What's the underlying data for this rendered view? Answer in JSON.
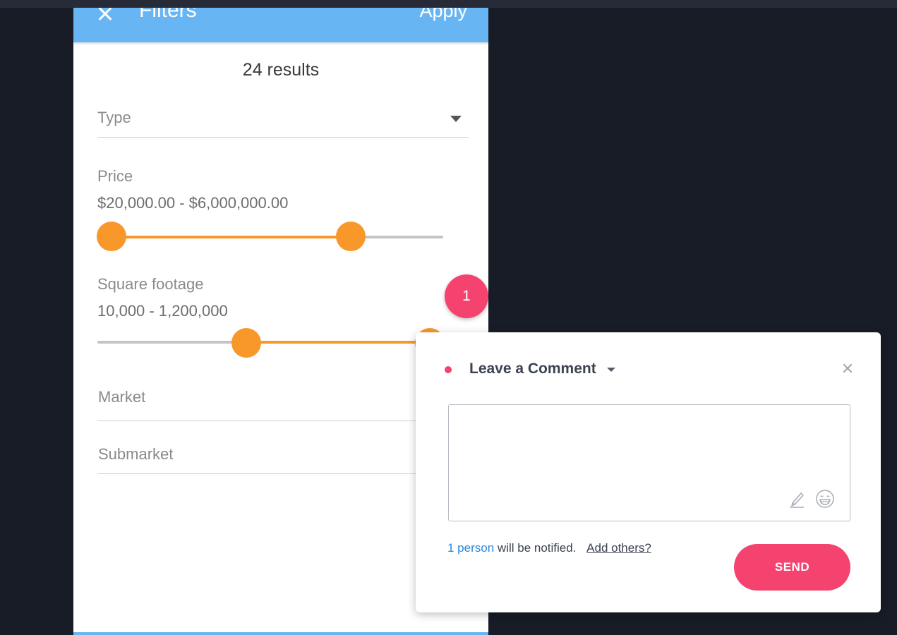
{
  "filters": {
    "close_icon": "close-icon",
    "title": "Filters",
    "apply_label": "Apply",
    "results": "24 results",
    "type_label": "Type",
    "price": {
      "label": "Price",
      "value": "$20,000.00 - $6,000,000.00",
      "range_fraction": [
        0.0,
        0.69
      ]
    },
    "square_footage": {
      "label": "Square footage",
      "value": "10,000 - 1,200,000",
      "range_fraction": [
        0.43,
        0.96
      ]
    },
    "market_label": "Market",
    "submarket_label": "Submarket",
    "colors": {
      "header": "#68b5f4",
      "slider": "#f8982b"
    }
  },
  "comment": {
    "badge_count": "1",
    "title": "Leave a Comment",
    "notify_count": "1 person",
    "notify_text": "will be notified.",
    "add_others": "Add others?",
    "send_label": "SEND",
    "icons": [
      "pen-icon",
      "emoji-icon",
      "close-icon",
      "chevron-down-icon"
    ],
    "accent": "#f4436f"
  }
}
